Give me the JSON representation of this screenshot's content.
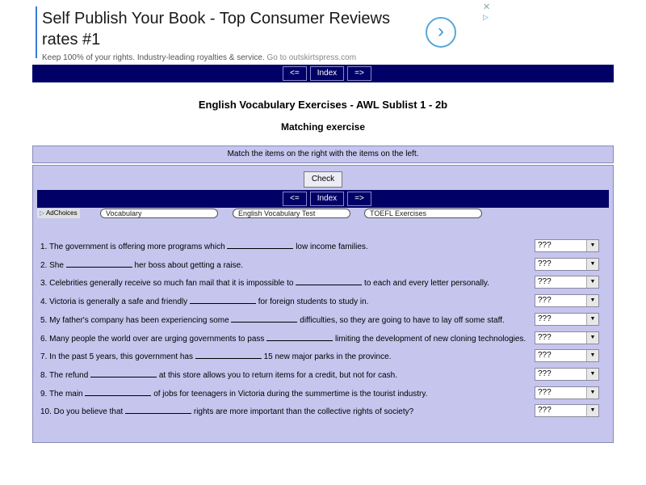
{
  "ad": {
    "headline": "Self Publish Your Book - Top Consumer Reviews rates #1",
    "description": "Keep 100% of your rights. Industry-leading royalties & service.",
    "goto": "Go to outskirtspress.com",
    "arrow": "›",
    "close": "✕",
    "choices_glyph": "▷"
  },
  "nav": {
    "prev": "<=",
    "index": "Index",
    "next": "=>"
  },
  "page": {
    "title": "English Vocabulary Exercises - AWL Sublist 1 - 2b",
    "subtitle": "Matching exercise",
    "instructions": "Match the items on the right with the items on the left."
  },
  "check_label": "Check",
  "links": {
    "adchoices": "AdChoices",
    "items": [
      "Vocabulary",
      "English Vocabulary Test",
      "TOEFL Exercises"
    ]
  },
  "questions": [
    {
      "before": "1. The government is offering more programs which",
      "after": "low income families."
    },
    {
      "before": "2. She",
      "after": "her boss about getting a raise."
    },
    {
      "before": "3. Celebrities generally receive so much fan mail that it is impossible to",
      "after": "to each and every letter personally."
    },
    {
      "before": "4. Victoria is generally a safe and friendly",
      "after": "for foreign students to study in."
    },
    {
      "before": "5. My father's company has been experiencing some",
      "after": "difficulties, so they are going to have to lay off some staff."
    },
    {
      "before": "6. Many people the world over are urging governments to pass",
      "after": "limiting the development of new cloning technologies."
    },
    {
      "before": "7. In the past 5 years, this government has",
      "after": "15 new major parks in the province."
    },
    {
      "before": "8. The refund",
      "after": "at this store allows you to return items for a credit, but not for cash."
    },
    {
      "before": "9. The main",
      "after": "of jobs for teenagers in Victoria during the summertime is the tourist industry."
    },
    {
      "before": "10. Do you believe that",
      "after": "rights are more important than the collective rights of society?"
    }
  ],
  "select_value": "???",
  "colors": {
    "navbar": "#000066",
    "panel": "#c5c5ee",
    "accent": "#3a7bd5"
  }
}
